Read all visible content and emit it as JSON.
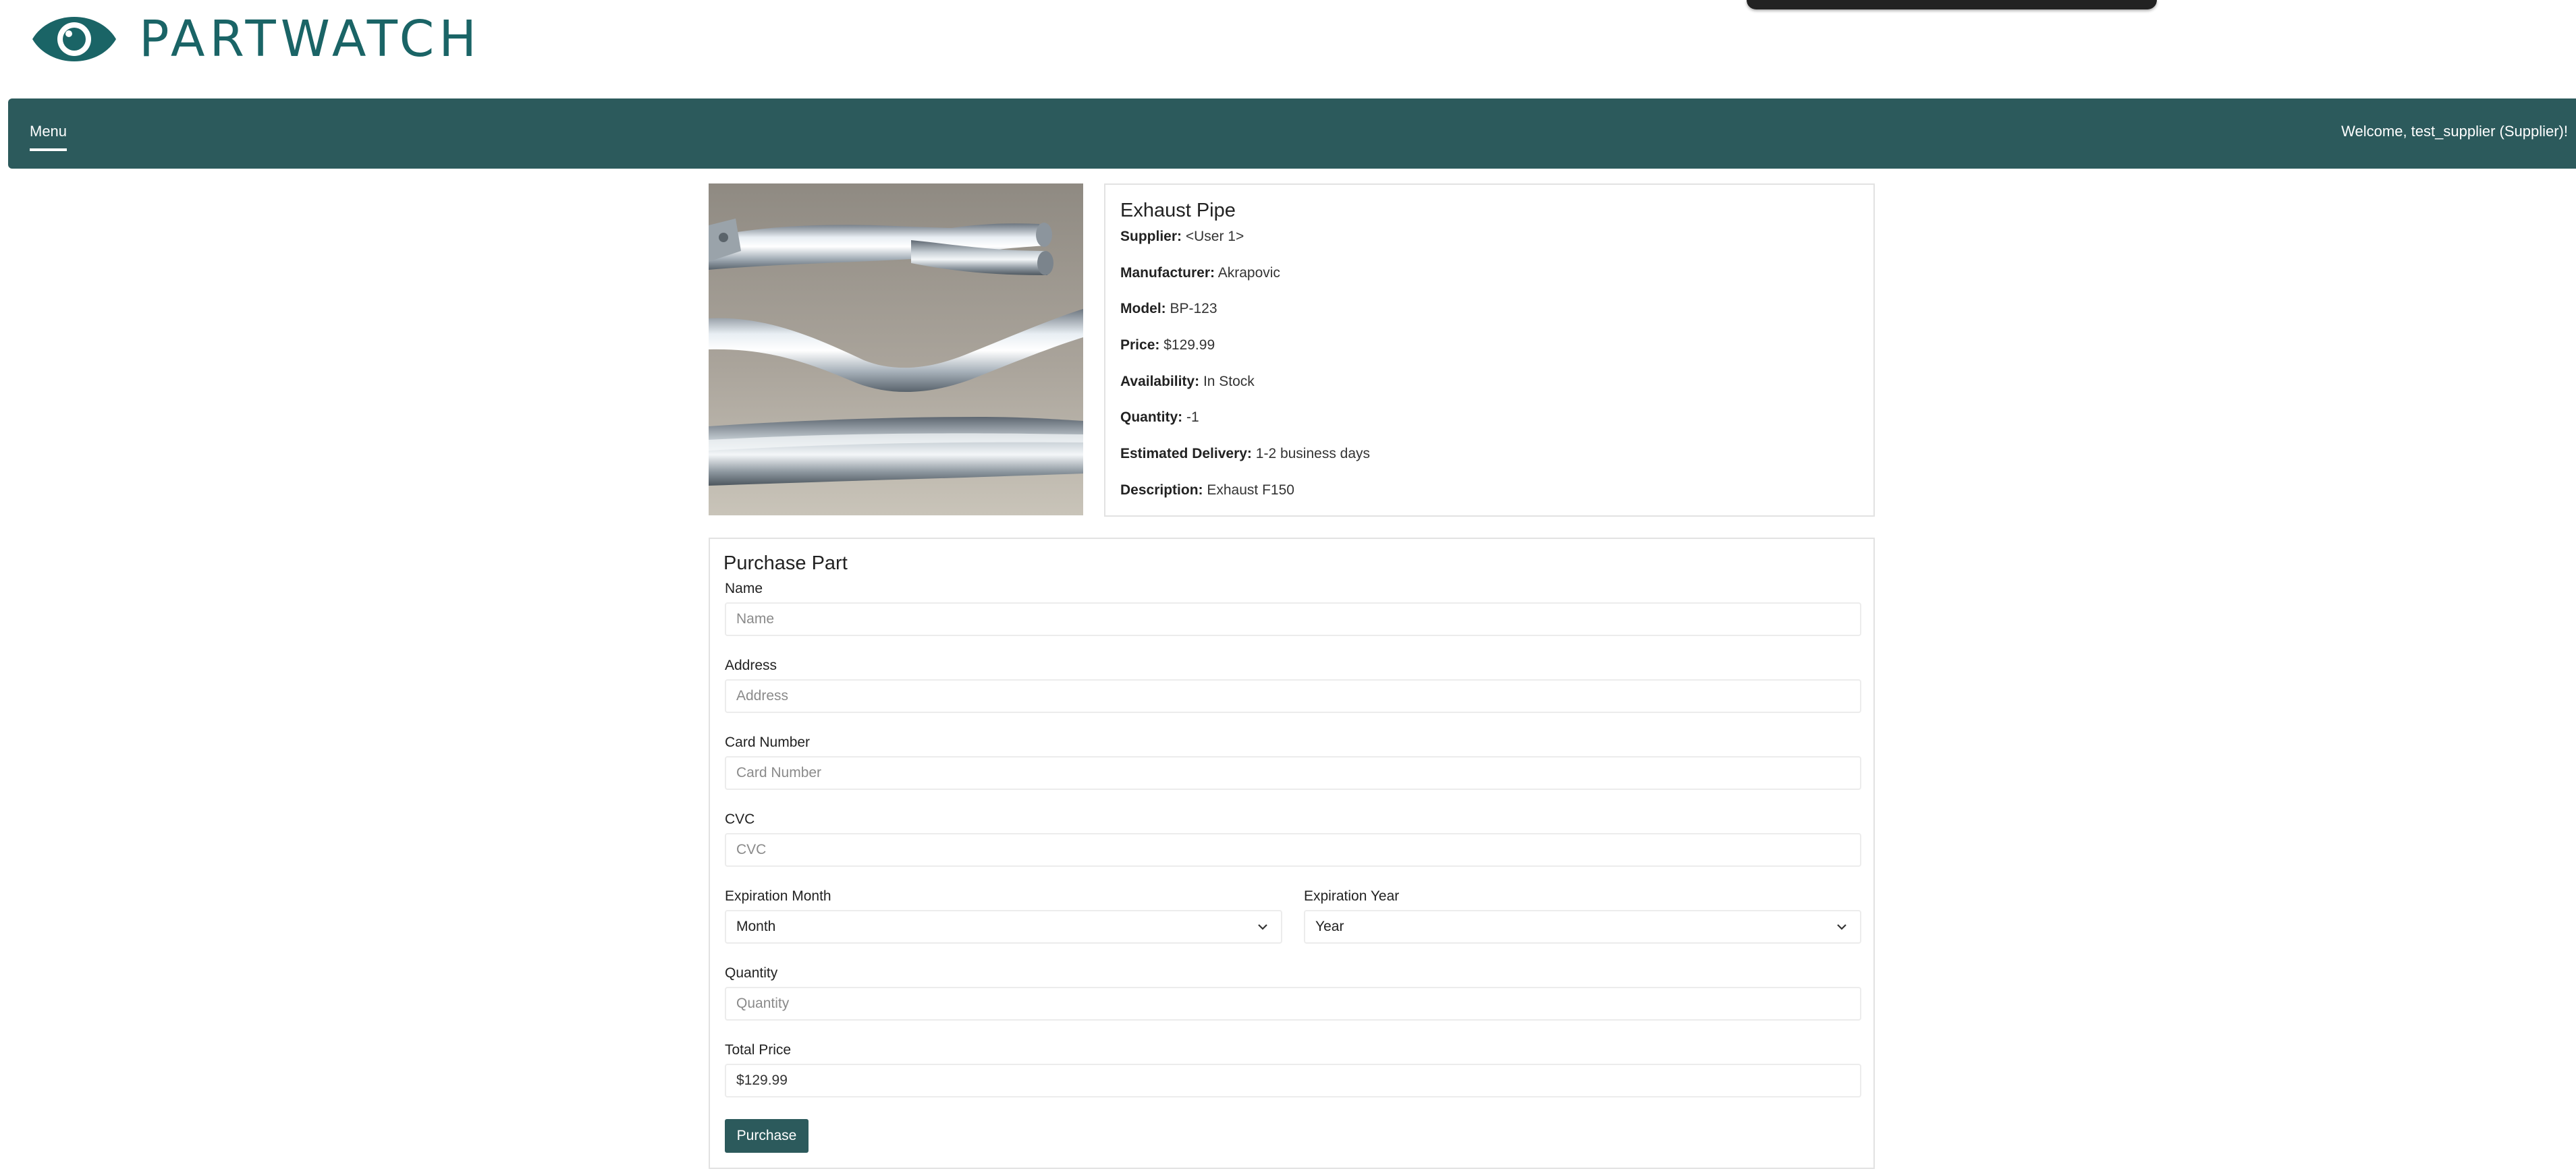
{
  "brand": {
    "name": "PARTWATCH",
    "color": "#1a6466",
    "icon": "eye-icon"
  },
  "nav": {
    "menu_label": "Menu",
    "welcome": "Welcome, test_supplier (Supplier)!"
  },
  "product": {
    "image_alt": "exhaust-pipe-photo",
    "title": "Exhaust Pipe",
    "fields": [
      {
        "label": "Supplier:",
        "value": "<User 1>"
      },
      {
        "label": "Manufacturer:",
        "value": "Akrapovic"
      },
      {
        "label": "Model:",
        "value": "BP-123"
      },
      {
        "label": "Price:",
        "value": "$129.99"
      },
      {
        "label": "Availability:",
        "value": "In Stock"
      },
      {
        "label": "Quantity:",
        "value": "-1"
      },
      {
        "label": "Estimated Delivery:",
        "value": "1-2 business days"
      },
      {
        "label": "Description:",
        "value": "Exhaust F150"
      }
    ]
  },
  "purchase": {
    "title": "Purchase Part",
    "name": {
      "label": "Name",
      "placeholder": "Name",
      "value": ""
    },
    "address": {
      "label": "Address",
      "placeholder": "Address",
      "value": ""
    },
    "card": {
      "label": "Card Number",
      "placeholder": "Card Number",
      "value": ""
    },
    "cvc": {
      "label": "CVC",
      "placeholder": "CVC",
      "value": ""
    },
    "exp_month": {
      "label": "Expiration Month",
      "selected": "Month"
    },
    "exp_year": {
      "label": "Expiration Year",
      "selected": "Year"
    },
    "quantity": {
      "label": "Quantity",
      "placeholder": "Quantity",
      "value": ""
    },
    "total": {
      "label": "Total Price",
      "value": "$129.99"
    },
    "button_label": "Purchase"
  },
  "colors": {
    "accent": "#2c5a5c",
    "border": "#e2e2e2"
  }
}
